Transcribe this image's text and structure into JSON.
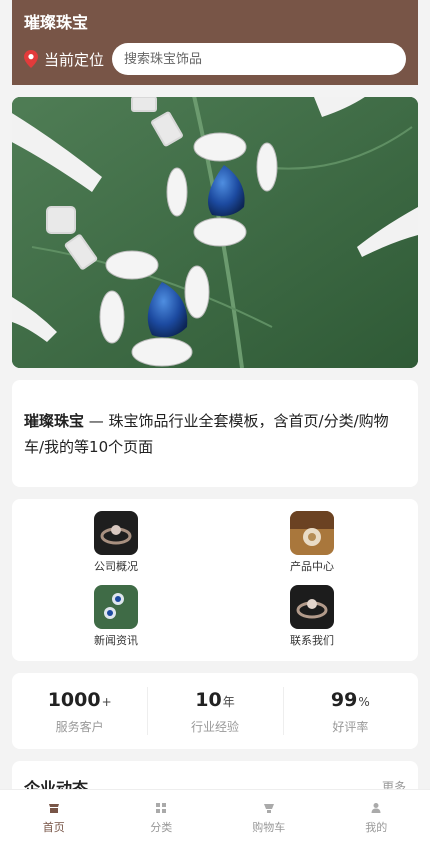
{
  "header": {
    "brand": "璀璨珠宝",
    "location_label": "当前定位",
    "search_placeholder": "搜索珠宝饰品"
  },
  "intro": {
    "brand": "璀璨珠宝",
    "text": " — 珠宝饰品行业全套模板，含首页/分类/购物车/我的等10个页面"
  },
  "grid": {
    "items": [
      {
        "label": "公司概况"
      },
      {
        "label": "产品中心"
      },
      {
        "label": "新闻资讯"
      },
      {
        "label": "联系我们"
      }
    ]
  },
  "stats": [
    {
      "value": "1000",
      "unit": "+",
      "label": "服务客户"
    },
    {
      "value": "10",
      "unit": "年",
      "label": "行业经验"
    },
    {
      "value": "99",
      "unit": "%",
      "label": "好评率"
    }
  ],
  "news": {
    "title": "企业动态",
    "more": "更多"
  },
  "tabbar": {
    "tabs": [
      {
        "label": "首页"
      },
      {
        "label": "分类"
      },
      {
        "label": "购物车"
      },
      {
        "label": "我的"
      }
    ],
    "active": "首页"
  },
  "colors": {
    "brand": "#785547",
    "background": "#f3f3f3"
  }
}
